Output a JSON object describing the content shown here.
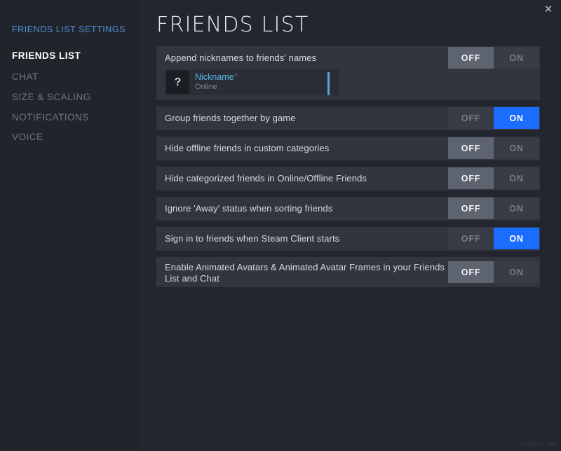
{
  "window": {
    "close_icon": "✕"
  },
  "sidebar": {
    "heading": "FRIENDS LIST SETTINGS",
    "items": [
      {
        "label": "FRIENDS LIST",
        "active": true
      },
      {
        "label": "CHAT",
        "active": false
      },
      {
        "label": "SIZE & SCALING",
        "active": false
      },
      {
        "label": "NOTIFICATIONS",
        "active": false
      },
      {
        "label": "VOICE",
        "active": false
      }
    ]
  },
  "main": {
    "title": "FRIENDS LIST",
    "settings": [
      {
        "label": "Append nicknames to friends' names",
        "off_label": "OFF",
        "on_label": "ON",
        "value": "OFF",
        "preview": {
          "avatar_glyph": "?",
          "name": "Nickname",
          "star": "*",
          "status": "Online"
        }
      },
      {
        "label": "Group friends together by game",
        "off_label": "OFF",
        "on_label": "ON",
        "value": "ON"
      },
      {
        "label": "Hide offline friends in custom categories",
        "off_label": "OFF",
        "on_label": "ON",
        "value": "OFF"
      },
      {
        "label": "Hide categorized friends in Online/Offline Friends",
        "off_label": "OFF",
        "on_label": "ON",
        "value": "OFF"
      },
      {
        "label": "Ignore 'Away' status when sorting friends",
        "off_label": "OFF",
        "on_label": "ON",
        "value": "OFF"
      },
      {
        "label": "Sign in to friends when Steam Client starts",
        "off_label": "OFF",
        "on_label": "ON",
        "value": "ON"
      },
      {
        "label": "Enable Animated Avatars & Animated Avatar Frames in your Friends List and Chat",
        "off_label": "OFF",
        "on_label": "ON",
        "value": "OFF",
        "two_line": true
      }
    ]
  },
  "watermark": "wsxdn.com",
  "colors": {
    "accent_blue": "#1a6dff",
    "link_blue": "#4c8ed6",
    "nickname_cyan": "#5cb3e0",
    "row_bg": "#32353d",
    "panel_bg": "#23262e",
    "sidebar_bg": "#21242b",
    "toggle_off_active": "#5d6470"
  }
}
